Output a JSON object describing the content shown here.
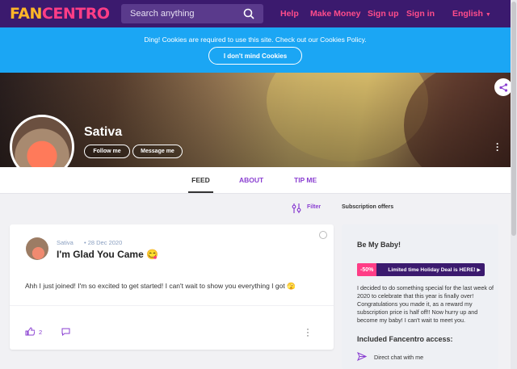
{
  "brand": {
    "logo_text_1": "FAN",
    "logo_text_2": "CENTRO"
  },
  "nav": {
    "search_placeholder": "Search anything",
    "links": [
      "Help",
      "Make Money",
      "Sign up",
      "Sign in"
    ],
    "language": "English"
  },
  "cookie": {
    "message": "Ding! Cookies are required to use this site. Check out our Cookies Policy.",
    "button": "I don't mind Cookies"
  },
  "profile": {
    "name": "Sativa",
    "follow_label": "Follow me",
    "message_label": "Message me"
  },
  "tabs": [
    "FEED",
    "ABOUT",
    "TIP ME"
  ],
  "feed": {
    "filter_label": "Filter",
    "subscription_label": "Subscription offers"
  },
  "post": {
    "author": "Sativa",
    "date": "28 Dec 2020",
    "title": "I'm Glad You Came 😋",
    "body": "Ahh I just joined! I'm so excited to get started! I can't wait to show you everything I got 🫣",
    "likes": "2"
  },
  "sidebar": {
    "title": "Be My Baby!",
    "deal_badge": "-50%",
    "deal_text": "Limited time Holiday Deal is HERE!",
    "description": "I decided to do something special for the last week of 2020 to celebrate that this year is finally over! Congratulations you made it, as a reward my subscription price is half off!! Now hurry up and become my baby! I can't wait to meet you.",
    "access_title": "Included Fancentro access:",
    "access_items": [
      "Direct chat with me"
    ]
  },
  "colors": {
    "nav_bg": "#3b1a6e",
    "accent_pink": "#ff3d86",
    "accent_purple": "#8a3fd1",
    "cookie_bg": "#1ba6f4"
  }
}
